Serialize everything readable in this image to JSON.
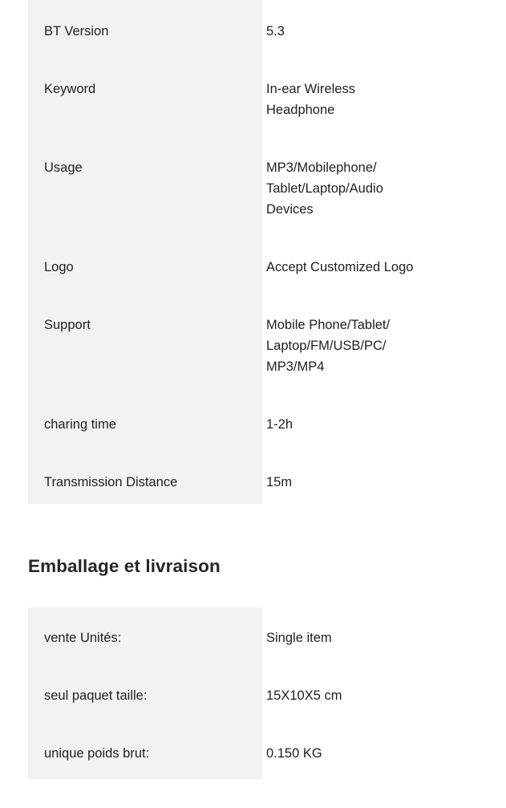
{
  "colors": {
    "page_background": "#ffffff",
    "label_column_background": "#f2f2f2",
    "text": "#1f1f1f",
    "heading_text": "#262626"
  },
  "specifications": {
    "rows": [
      {
        "label": "BT Version",
        "value": "5.3"
      },
      {
        "label": "Keyword",
        "value": "In-ear Wireless\nHeadphone"
      },
      {
        "label": "Usage",
        "value": "MP3/Mobilephone/\nTablet/Laptop/Audio\nDevices"
      },
      {
        "label": "Logo",
        "value": "Accept Customized Logo"
      },
      {
        "label": "Support",
        "value": "Mobile Phone/Tablet/\nLaptop/FM/USB/PC/\nMP3/MP4"
      },
      {
        "label": "charing time",
        "value": "1-2h"
      },
      {
        "label": "Transmission Distance",
        "value": "15m"
      }
    ]
  },
  "packaging": {
    "heading": "Emballage et livraison",
    "rows": [
      {
        "label": "vente Unités:",
        "value": "Single item"
      },
      {
        "label": "seul paquet taille:",
        "value": "15X10X5 cm"
      },
      {
        "label": "unique poids brut:",
        "value": "0.150 KG"
      }
    ]
  }
}
